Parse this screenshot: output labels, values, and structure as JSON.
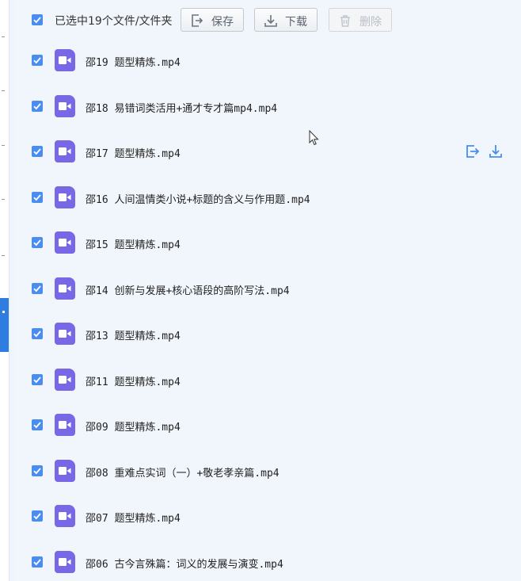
{
  "toolbar": {
    "selection_text": "已选中19个文件/文件夹",
    "save_label": "保存",
    "download_label": "下载",
    "delete_label": "删除"
  },
  "files": [
    {
      "name": "邵19 题型精炼.mp4"
    },
    {
      "name": "邵18 易错词类活用+通才专才篇mp4.mp4"
    },
    {
      "name": "邵17 题型精炼.mp4"
    },
    {
      "name": "邵16 人间温情类小说+标题的含义与作用题.mp4"
    },
    {
      "name": "邵15 题型精炼.mp4"
    },
    {
      "name": "邵14 创新与发展+核心语段的高阶写法.mp4"
    },
    {
      "name": "邵13 题型精炼.mp4"
    },
    {
      "name": "邵11 题型精炼.mp4"
    },
    {
      "name": "邵09 题型精炼.mp4"
    },
    {
      "name": "邵08 重难点实词（一）+敬老孝亲篇.mp4"
    },
    {
      "name": "邵07 题型精炼.mp4"
    },
    {
      "name": "邵06 古今言殊篇：词义的发展与演变.mp4"
    }
  ],
  "colors": {
    "accent": "#4a8df0",
    "file_icon": "#7868e6",
    "background": "#f1f6fc"
  }
}
